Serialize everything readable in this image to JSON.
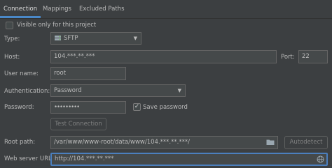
{
  "tabs": [
    {
      "label": "Connection",
      "active": true
    },
    {
      "label": "Mappings",
      "active": false
    },
    {
      "label": "Excluded Paths",
      "active": false
    }
  ],
  "visible_only": {
    "label": "Visible only for this project",
    "checked": false
  },
  "type": {
    "label": "Type:",
    "value": "SFTP",
    "icon": "sftp-server-icon"
  },
  "host": {
    "label": "Host:",
    "value": "104.***.**.***"
  },
  "port": {
    "label": "Port:",
    "value": "22"
  },
  "username": {
    "label": "User name:",
    "value": "root"
  },
  "authentication": {
    "label": "Authentication:",
    "value": "Password"
  },
  "password": {
    "label": "Password:",
    "value": "•••••••••"
  },
  "save_password": {
    "label": "Save password",
    "checked": true
  },
  "test_connection": {
    "label": "Test Connection"
  },
  "root_path": {
    "label": "Root path:",
    "value": "/var/www/www-root/data/www/104.***.**.***/"
  },
  "autodetect": {
    "label": "Autodetect"
  },
  "web_server_url": {
    "label": "Web server URL:",
    "value": "http://104.***.**.***"
  },
  "colors": {
    "accent": "#4a88c7",
    "background": "#3c3f41",
    "field": "#45494a",
    "focus_border": "#4b7fbd"
  }
}
